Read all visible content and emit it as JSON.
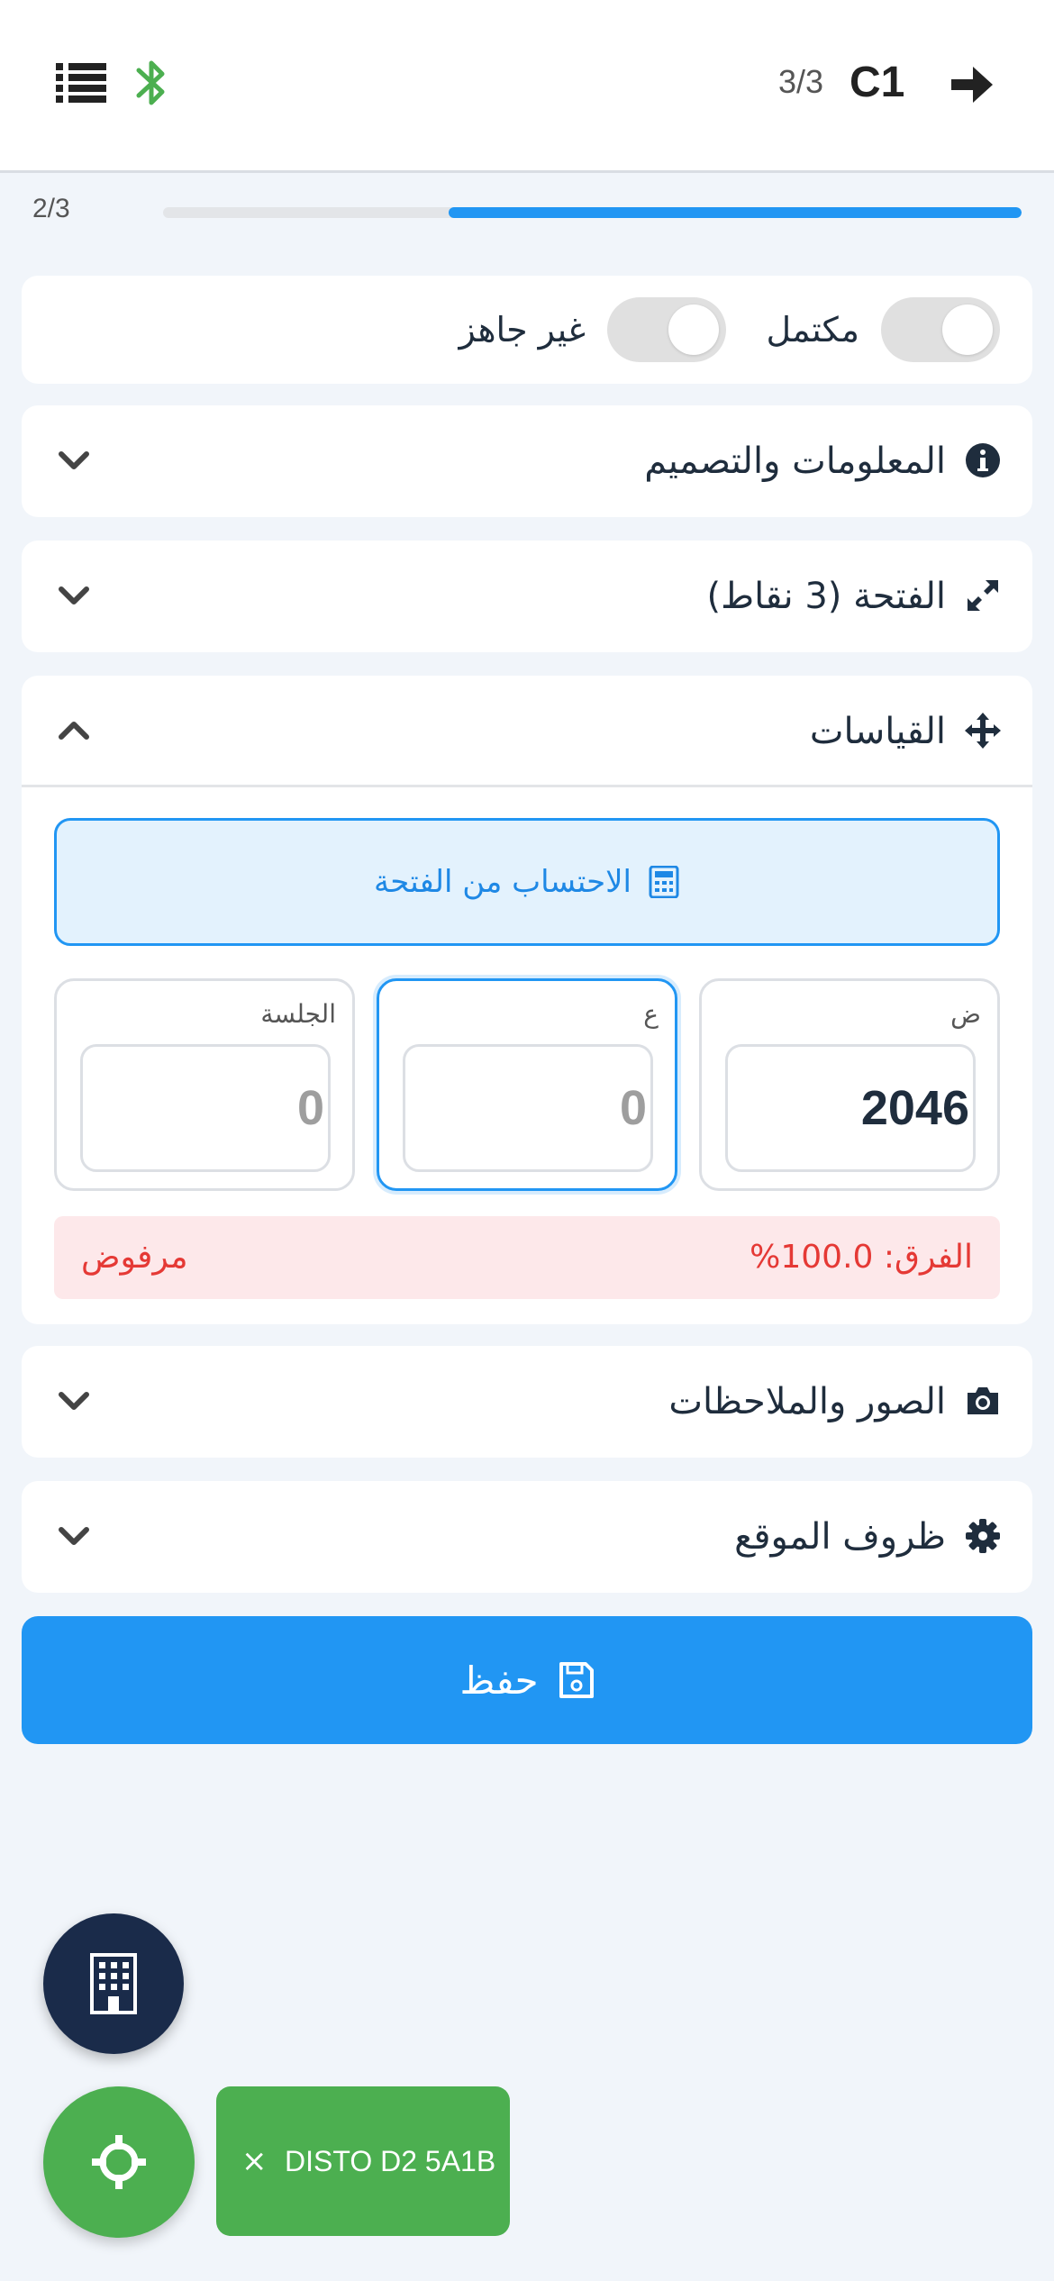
{
  "header": {
    "counter": "3/3",
    "code": "C1",
    "icons": [
      "list-icon",
      "bluetooth-icon",
      "arrow-right-icon"
    ],
    "bluetooth_color": "#4caf50"
  },
  "progress": {
    "step": "2/3",
    "fraction": 0.667,
    "fill_color": "#2196f3"
  },
  "status_toggles": {
    "complete_label": "مكتمل",
    "complete_on": false,
    "not_ready_label": "غير جاهز",
    "not_ready_on": false
  },
  "sections": {
    "info_design": {
      "title": "المعلومات والتصميم",
      "icon": "info-circle-icon",
      "expanded": false
    },
    "opening": {
      "title": "الفتحة (3 نقاط)",
      "icon": "expand-arrows-icon",
      "expanded": false
    },
    "measurements": {
      "title": "القياسات",
      "icon": "move-arrows-icon",
      "expanded": true
    },
    "photos_notes": {
      "title": "الصور والملاحظات",
      "icon": "camera-icon",
      "expanded": false
    },
    "site_conditions": {
      "title": "ظروف الموقع",
      "icon": "gear-icon",
      "expanded": false
    }
  },
  "measurements": {
    "calc_button": "الاحتساب من الفتحة",
    "width_label": "ض",
    "width_value": "2046",
    "height_label": "ع",
    "height_value": "",
    "height_placeholder": "0",
    "sill_label": "الجلسة",
    "sill_value": "",
    "sill_placeholder": "0",
    "diff_text": "الفرق: 100.0%",
    "status": "مرفوض",
    "status_color": "#e53935"
  },
  "save_button": {
    "label": "حفظ",
    "color": "#2196f3"
  },
  "fabs": {
    "building_icon": "building-icon",
    "target_icon": "crosshair-icon",
    "device_close": "×",
    "device_name": "DISTO D2 5A1B",
    "device_color": "#4caf50"
  }
}
